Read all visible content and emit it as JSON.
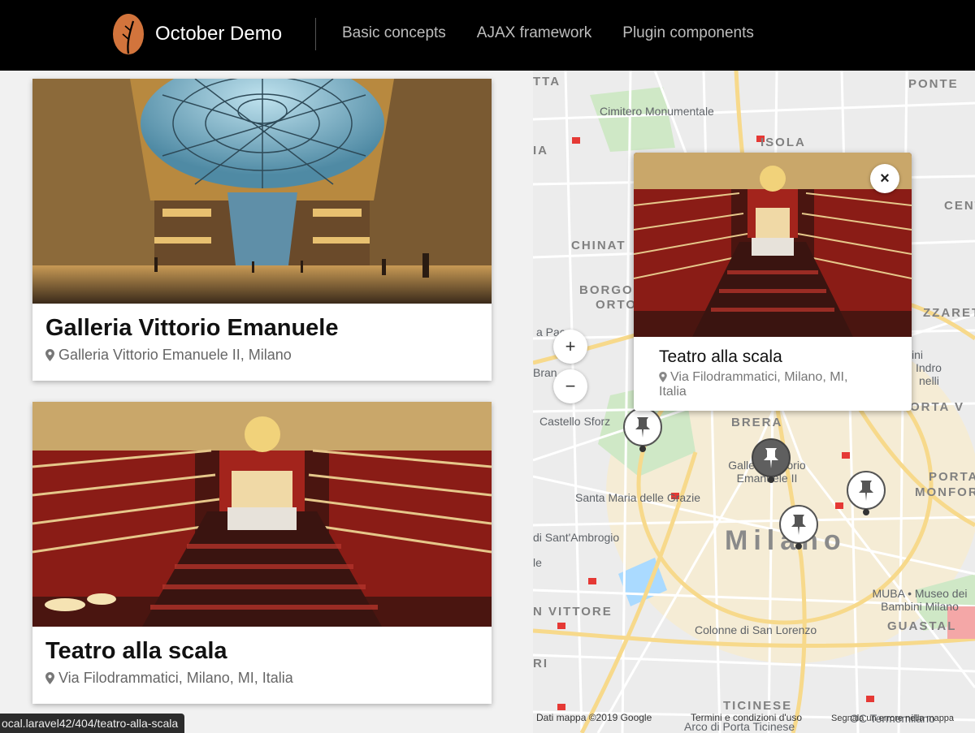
{
  "header": {
    "brand": "October Demo",
    "nav": [
      "Basic concepts",
      "AJAX framework",
      "Plugin components"
    ]
  },
  "places": [
    {
      "title": "Galleria Vittorio Emanuele",
      "address": "Galleria Vittorio Emanuele II, Milano"
    },
    {
      "title": "Teatro alla scala",
      "address": "Via Filodrammatici, Milano, MI, Italia"
    }
  ],
  "popup": {
    "title": "Teatro alla scala",
    "address": "Via Filodrammatici, Milano, MI, Italia",
    "close": "×"
  },
  "map": {
    "zoom_in": "+",
    "zoom_out": "−",
    "districts": [
      "TTA",
      "PONTE",
      "ISOLA",
      "CENT",
      "CHINAT",
      "BORGO",
      "ORTO",
      "ZZARET",
      "BRERA",
      "PORTA V",
      "PORTA",
      "MONFOR",
      "N VITTORE",
      "GUASTAL",
      "TICINESE",
      "Milano",
      "IA",
      "RI"
    ],
    "pois": [
      "Cimitero Monumentale",
      "a Pac",
      "Bran",
      "Castello Sforz",
      "Galleria Vittorio Emanuele II",
      "Santa Maria delle Grazie",
      "di Sant'Ambrogio",
      "le",
      "MUBA • Museo dei Bambini Milano",
      "Colonne di San Lorenzo",
      "ini",
      "Indro",
      "nelli",
      "Arco di Porta Ticinese",
      "OC Termemilano"
    ],
    "footer_data": "Dati mappa ©2019 Google",
    "footer_terms": "Termini e condizioni d'uso",
    "footer_report": "Segnala un errore nella mappa"
  },
  "status_url": "ocal.laravel42/404/teatro-alla-scala",
  "colors": {
    "header_bg": "#000000",
    "logo": "#d2743c",
    "marker_dark": "#5f5f5f"
  }
}
